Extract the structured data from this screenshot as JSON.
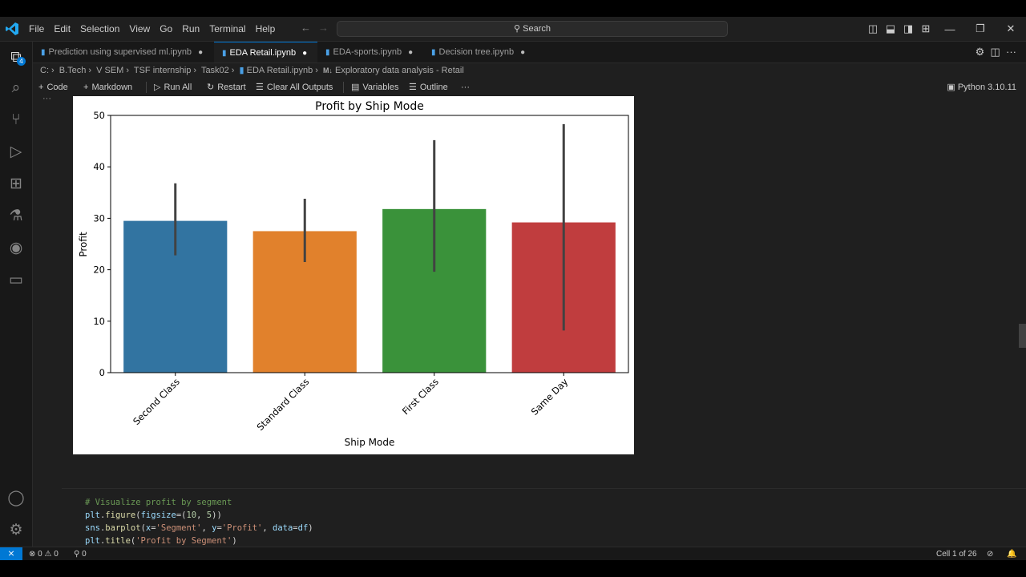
{
  "menu": [
    "File",
    "Edit",
    "Selection",
    "View",
    "Go",
    "Run",
    "Terminal",
    "Help"
  ],
  "search": {
    "label": "Search"
  },
  "tabs": [
    {
      "label": "Prediction using supervised ml.ipynb",
      "modified": "●"
    },
    {
      "label": "EDA Retail.ipynb",
      "modified": "●"
    },
    {
      "label": "EDA-sports.ipynb",
      "modified": "●"
    },
    {
      "label": "Decision tree.ipynb",
      "modified": "●"
    }
  ],
  "activity_badge": "4",
  "breadcrumb": [
    "C:",
    "B.Tech",
    "V SEM",
    "TSF internship",
    "Task02",
    "EDA Retail.ipynb",
    "Exploratory data analysis - Retail"
  ],
  "breadcrumb_md_tag": "M↓",
  "toolbar": {
    "code": "Code",
    "markdown": "Markdown",
    "run_all": "Run All",
    "restart": "Restart",
    "clear": "Clear All Outputs",
    "variables": "Variables",
    "outline": "Outline",
    "more": "···",
    "kernel": "Python 3.10.11"
  },
  "cell_ellipsis": "···",
  "chart_data": {
    "type": "bar",
    "title": "Profit by Ship Mode",
    "xlabel": "Ship Mode",
    "ylabel": "Profit",
    "categories": [
      "Second Class",
      "Standard Class",
      "First Class",
      "Same Day"
    ],
    "values": [
      29.5,
      27.5,
      31.8,
      29.2
    ],
    "error_low": [
      22.8,
      21.5,
      19.6,
      8.2
    ],
    "error_high": [
      36.8,
      33.8,
      45.2,
      48.3
    ],
    "colors": [
      "#3274a1",
      "#e1812c",
      "#3a923a",
      "#c03d3e"
    ],
    "yticks": [
      0,
      10,
      20,
      30,
      40,
      50
    ],
    "ylim": [
      0,
      50
    ],
    "grid": false
  },
  "code_lines": [
    [
      {
        "t": "# Visualize profit by segment",
        "c": "c-comment"
      }
    ],
    [
      {
        "t": "plt",
        "c": "c-id"
      },
      {
        "t": ".",
        "c": "c-pun"
      },
      {
        "t": "figure",
        "c": "c-fn"
      },
      {
        "t": "(",
        "c": "c-pun"
      },
      {
        "t": "figsize",
        "c": "c-id"
      },
      {
        "t": "=(",
        "c": "c-pun"
      },
      {
        "t": "10",
        "c": "c-num"
      },
      {
        "t": ", ",
        "c": "c-pun"
      },
      {
        "t": "5",
        "c": "c-num"
      },
      {
        "t": "))",
        "c": "c-pun"
      }
    ],
    [
      {
        "t": "sns",
        "c": "c-id"
      },
      {
        "t": ".",
        "c": "c-pun"
      },
      {
        "t": "barplot",
        "c": "c-fn"
      },
      {
        "t": "(",
        "c": "c-pun"
      },
      {
        "t": "x",
        "c": "c-id"
      },
      {
        "t": "=",
        "c": "c-pun"
      },
      {
        "t": "'Segment'",
        "c": "c-str"
      },
      {
        "t": ", ",
        "c": "c-pun"
      },
      {
        "t": "y",
        "c": "c-id"
      },
      {
        "t": "=",
        "c": "c-pun"
      },
      {
        "t": "'Profit'",
        "c": "c-str"
      },
      {
        "t": ", ",
        "c": "c-pun"
      },
      {
        "t": "data",
        "c": "c-id"
      },
      {
        "t": "=",
        "c": "c-pun"
      },
      {
        "t": "df",
        "c": "c-id"
      },
      {
        "t": ")",
        "c": "c-pun"
      }
    ],
    [
      {
        "t": "plt",
        "c": "c-id"
      },
      {
        "t": ".",
        "c": "c-pun"
      },
      {
        "t": "title",
        "c": "c-fn"
      },
      {
        "t": "(",
        "c": "c-pun"
      },
      {
        "t": "'Profit by Segment'",
        "c": "c-str"
      },
      {
        "t": ")",
        "c": "c-pun"
      }
    ]
  ],
  "status": {
    "remote": "⨯",
    "errors": "0",
    "warnings": "0",
    "ports": "0",
    "cell": "Cell 1 of 26"
  },
  "colors": {
    "accent": "#0078d4"
  }
}
